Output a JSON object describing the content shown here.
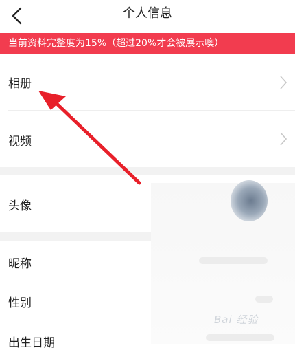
{
  "header": {
    "title": "个人信息",
    "back_icon": "chevron-left-icon"
  },
  "banner": {
    "text": "当前资料完整度为15%（超过20%才会被展示噢）",
    "color": "#f23c4f"
  },
  "rows": [
    {
      "id": "album",
      "label": "相册",
      "icon": "chevron-right-icon"
    },
    {
      "id": "video",
      "label": "视频",
      "icon": "chevron-right-icon"
    },
    {
      "id": "avatar",
      "label": "头像"
    },
    {
      "id": "nickname",
      "label": "昵称"
    },
    {
      "id": "gender",
      "label": "性别"
    },
    {
      "id": "birthday",
      "label": "出生日期"
    }
  ],
  "annotation": {
    "color": "#e8202a"
  },
  "watermark": {
    "text": "Bai 经验"
  }
}
